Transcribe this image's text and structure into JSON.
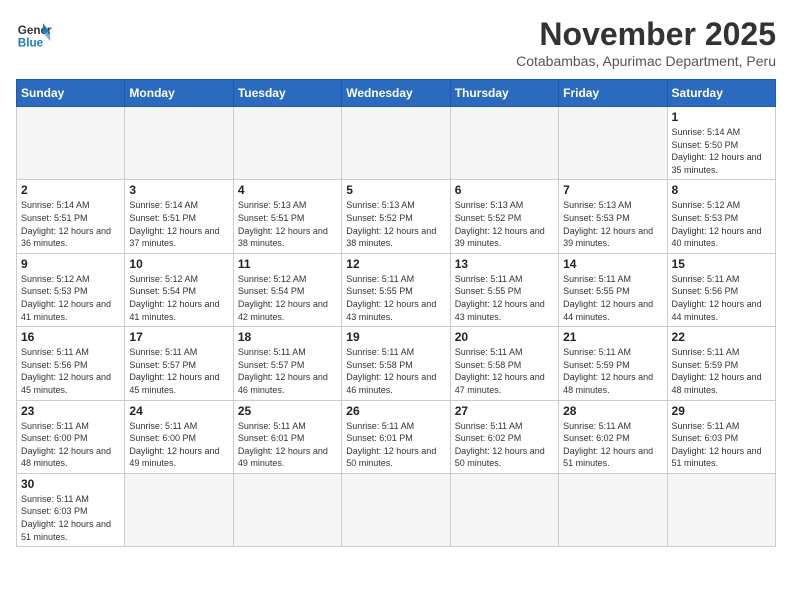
{
  "logo": {
    "line1": "General",
    "line2": "Blue"
  },
  "header": {
    "month_title": "November 2025",
    "subtitle": "Cotabambas, Apurimac Department, Peru"
  },
  "weekdays": [
    "Sunday",
    "Monday",
    "Tuesday",
    "Wednesday",
    "Thursday",
    "Friday",
    "Saturday"
  ],
  "days": {
    "1": {
      "sunrise": "5:14 AM",
      "sunset": "5:50 PM",
      "daylight": "12 hours and 35 minutes."
    },
    "2": {
      "sunrise": "5:14 AM",
      "sunset": "5:51 PM",
      "daylight": "12 hours and 36 minutes."
    },
    "3": {
      "sunrise": "5:14 AM",
      "sunset": "5:51 PM",
      "daylight": "12 hours and 37 minutes."
    },
    "4": {
      "sunrise": "5:13 AM",
      "sunset": "5:51 PM",
      "daylight": "12 hours and 38 minutes."
    },
    "5": {
      "sunrise": "5:13 AM",
      "sunset": "5:52 PM",
      "daylight": "12 hours and 38 minutes."
    },
    "6": {
      "sunrise": "5:13 AM",
      "sunset": "5:52 PM",
      "daylight": "12 hours and 39 minutes."
    },
    "7": {
      "sunrise": "5:13 AM",
      "sunset": "5:53 PM",
      "daylight": "12 hours and 39 minutes."
    },
    "8": {
      "sunrise": "5:12 AM",
      "sunset": "5:53 PM",
      "daylight": "12 hours and 40 minutes."
    },
    "9": {
      "sunrise": "5:12 AM",
      "sunset": "5:53 PM",
      "daylight": "12 hours and 41 minutes."
    },
    "10": {
      "sunrise": "5:12 AM",
      "sunset": "5:54 PM",
      "daylight": "12 hours and 41 minutes."
    },
    "11": {
      "sunrise": "5:12 AM",
      "sunset": "5:54 PM",
      "daylight": "12 hours and 42 minutes."
    },
    "12": {
      "sunrise": "5:11 AM",
      "sunset": "5:55 PM",
      "daylight": "12 hours and 43 minutes."
    },
    "13": {
      "sunrise": "5:11 AM",
      "sunset": "5:55 PM",
      "daylight": "12 hours and 43 minutes."
    },
    "14": {
      "sunrise": "5:11 AM",
      "sunset": "5:55 PM",
      "daylight": "12 hours and 44 minutes."
    },
    "15": {
      "sunrise": "5:11 AM",
      "sunset": "5:56 PM",
      "daylight": "12 hours and 44 minutes."
    },
    "16": {
      "sunrise": "5:11 AM",
      "sunset": "5:56 PM",
      "daylight": "12 hours and 45 minutes."
    },
    "17": {
      "sunrise": "5:11 AM",
      "sunset": "5:57 PM",
      "daylight": "12 hours and 45 minutes."
    },
    "18": {
      "sunrise": "5:11 AM",
      "sunset": "5:57 PM",
      "daylight": "12 hours and 46 minutes."
    },
    "19": {
      "sunrise": "5:11 AM",
      "sunset": "5:58 PM",
      "daylight": "12 hours and 46 minutes."
    },
    "20": {
      "sunrise": "5:11 AM",
      "sunset": "5:58 PM",
      "daylight": "12 hours and 47 minutes."
    },
    "21": {
      "sunrise": "5:11 AM",
      "sunset": "5:59 PM",
      "daylight": "12 hours and 48 minutes."
    },
    "22": {
      "sunrise": "5:11 AM",
      "sunset": "5:59 PM",
      "daylight": "12 hours and 48 minutes."
    },
    "23": {
      "sunrise": "5:11 AM",
      "sunset": "6:00 PM",
      "daylight": "12 hours and 48 minutes."
    },
    "24": {
      "sunrise": "5:11 AM",
      "sunset": "6:00 PM",
      "daylight": "12 hours and 49 minutes."
    },
    "25": {
      "sunrise": "5:11 AM",
      "sunset": "6:01 PM",
      "daylight": "12 hours and 49 minutes."
    },
    "26": {
      "sunrise": "5:11 AM",
      "sunset": "6:01 PM",
      "daylight": "12 hours and 50 minutes."
    },
    "27": {
      "sunrise": "5:11 AM",
      "sunset": "6:02 PM",
      "daylight": "12 hours and 50 minutes."
    },
    "28": {
      "sunrise": "5:11 AM",
      "sunset": "6:02 PM",
      "daylight": "12 hours and 51 minutes."
    },
    "29": {
      "sunrise": "5:11 AM",
      "sunset": "6:03 PM",
      "daylight": "12 hours and 51 minutes."
    },
    "30": {
      "sunrise": "5:11 AM",
      "sunset": "6:03 PM",
      "daylight": "12 hours and 51 minutes."
    }
  },
  "labels": {
    "sunrise": "Sunrise:",
    "sunset": "Sunset:",
    "daylight": "Daylight:"
  }
}
